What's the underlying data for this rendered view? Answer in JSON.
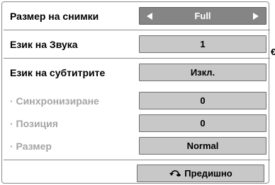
{
  "menu": {
    "rows": [
      {
        "label": "Размер на снимки",
        "value": "Full",
        "disabled": false,
        "active": true
      },
      {
        "label": "Език на Звука",
        "value": "1",
        "disabled": false,
        "active": false
      },
      {
        "label": "Език на субтитрите",
        "value": "Изкл.",
        "disabled": false,
        "active": false
      },
      {
        "label": "· Синхронизиране",
        "value": "0",
        "disabled": true,
        "active": false
      },
      {
        "label": "· Позиция",
        "value": "0",
        "disabled": true,
        "active": false
      },
      {
        "label": "· Размер",
        "value": "Normal",
        "disabled": true,
        "active": false
      }
    ],
    "return_label": "Предишно",
    "side_mark": "€"
  }
}
